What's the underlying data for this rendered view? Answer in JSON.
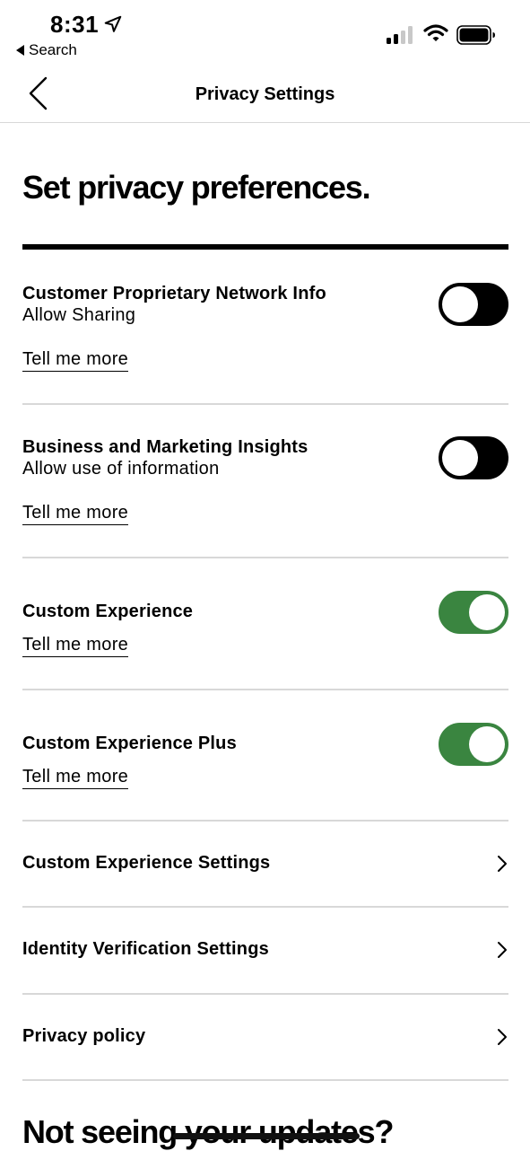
{
  "status_bar": {
    "time": "8:31",
    "back_app_label": "Search",
    "icons": [
      "location-arrow-icon",
      "cellular-signal-icon",
      "wifi-icon",
      "battery-icon"
    ]
  },
  "nav": {
    "title": "Privacy Settings",
    "back_icon": "chevron-left-icon"
  },
  "page": {
    "heading": "Set privacy preferences.",
    "bottom_heading": "Not seeing your updates?"
  },
  "toggles": [
    {
      "title": "Customer Proprietary Network Info",
      "subtitle": "Allow Sharing",
      "link": "Tell me more",
      "enabled": false
    },
    {
      "title": "Business and Marketing Insights",
      "subtitle": "Allow use of information",
      "link": "Tell me more",
      "enabled": false
    },
    {
      "title": "Custom Experience",
      "link": "Tell me more",
      "enabled": true
    },
    {
      "title": "Custom Experience Plus",
      "link": "Tell me more",
      "enabled": true
    }
  ],
  "links": [
    {
      "label": "Custom Experience Settings",
      "icon": "chevron-right-icon"
    },
    {
      "label": "Identity Verification Settings",
      "icon": "chevron-right-icon"
    },
    {
      "label": "Privacy policy",
      "icon": "chevron-right-icon"
    }
  ],
  "colors": {
    "toggle_on": "#3a8540",
    "toggle_off": "#000000",
    "divider": "#d8d8d8",
    "text": "#000000"
  }
}
